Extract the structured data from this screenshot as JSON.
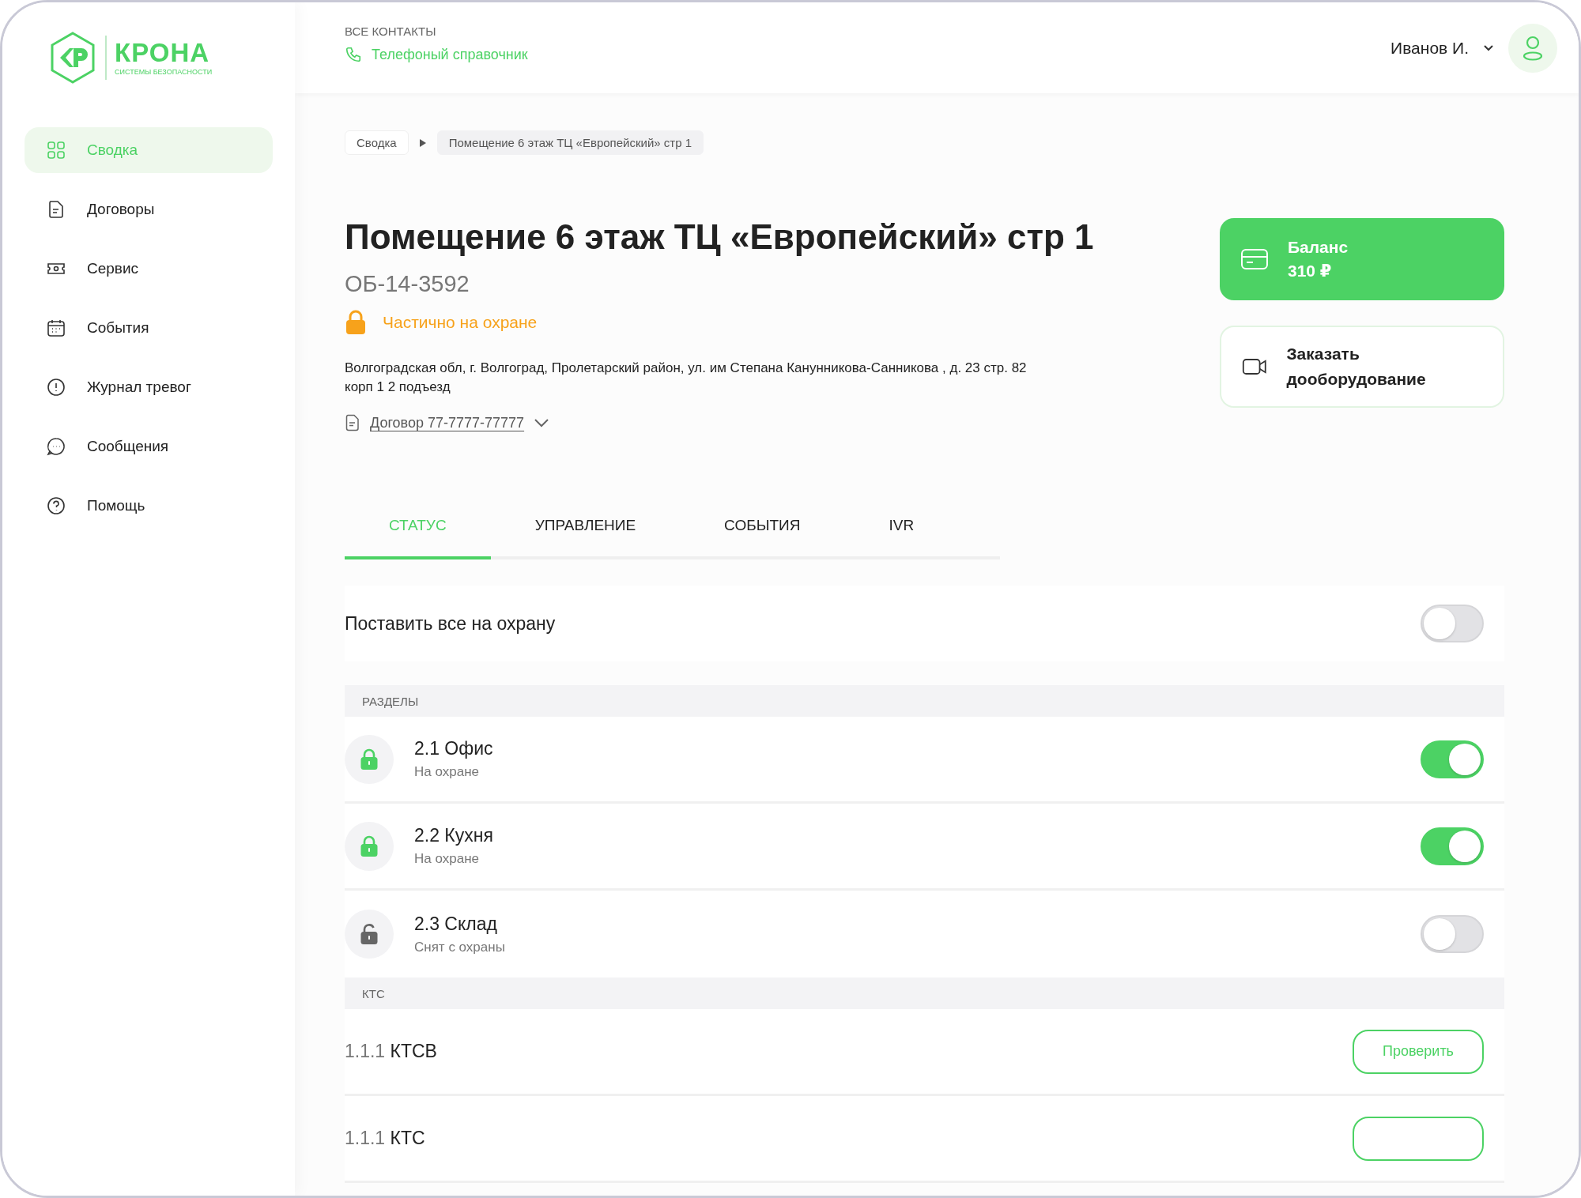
{
  "logo": {
    "name": "КРОНА",
    "tagline": "СИСТЕМЫ БЕЗОПАСНОСТИ"
  },
  "sidebar": {
    "items": [
      {
        "label": "Сводка",
        "kind": "grid",
        "selected": true
      },
      {
        "label": "Договоры",
        "kind": "document",
        "selected": false
      },
      {
        "label": "Сервис",
        "kind": "ticket",
        "selected": false
      },
      {
        "label": "События",
        "kind": "calendar",
        "selected": false
      },
      {
        "label": "Журнал тревог",
        "kind": "alert",
        "selected": false
      },
      {
        "label": "Сообщения",
        "kind": "chat",
        "selected": false
      },
      {
        "label": "Помощь",
        "kind": "help",
        "selected": false
      }
    ]
  },
  "header": {
    "contacts_label": "ВСЕ КОНТАКТЫ",
    "phonebook_link": "Телефоный справочник",
    "user_name": "Иванов И."
  },
  "breadcrumbs": [
    "Сводка",
    "Помещение 6 этаж ТЦ «Европейский» стр 1"
  ],
  "object": {
    "title": "Помещение 6 этаж ТЦ «Европейский» стр 1",
    "code": "ОБ-14-3592",
    "status": "Частично на охране",
    "address": "Волгоградская обл, г. Волгоград, Пролетарский район, ул. им Степана Канунникова-Санникова , д. 23 стр. 82 корп 1 2 подъезд",
    "contract": "Договор 77-7777-77777"
  },
  "balance": {
    "label": "Баланс",
    "amount": "310 ₽"
  },
  "order_button": "Заказать дооборудование",
  "tabs": [
    {
      "label": "СТАТУС",
      "selected": true
    },
    {
      "label": "УПРАВЛЕНИЕ",
      "selected": false
    },
    {
      "label": "СОБЫТИЯ",
      "selected": false
    },
    {
      "label": "IVR",
      "selected": false
    }
  ],
  "arm_all": {
    "label": "Поставить все на охрану",
    "on": false
  },
  "sections": [
    {
      "title": "РАЗДЕЛЫ",
      "rows": [
        {
          "kind": "zone",
          "name": "2.1 Офис",
          "status": "На охране",
          "on": true
        },
        {
          "kind": "zone",
          "name": "2.2 Кухня",
          "status": "На охране",
          "on": true
        },
        {
          "kind": "zone",
          "name": "2.3 Склад",
          "status": "Снят с охраны",
          "on": false
        }
      ]
    },
    {
      "title": "КТС",
      "rows": [
        {
          "kind": "panic",
          "number": "1.1.1",
          "name": "КТСВ",
          "button": "Проверить"
        },
        {
          "kind": "panic",
          "number": "1.1.1",
          "name": "КТС"
        }
      ]
    }
  ]
}
